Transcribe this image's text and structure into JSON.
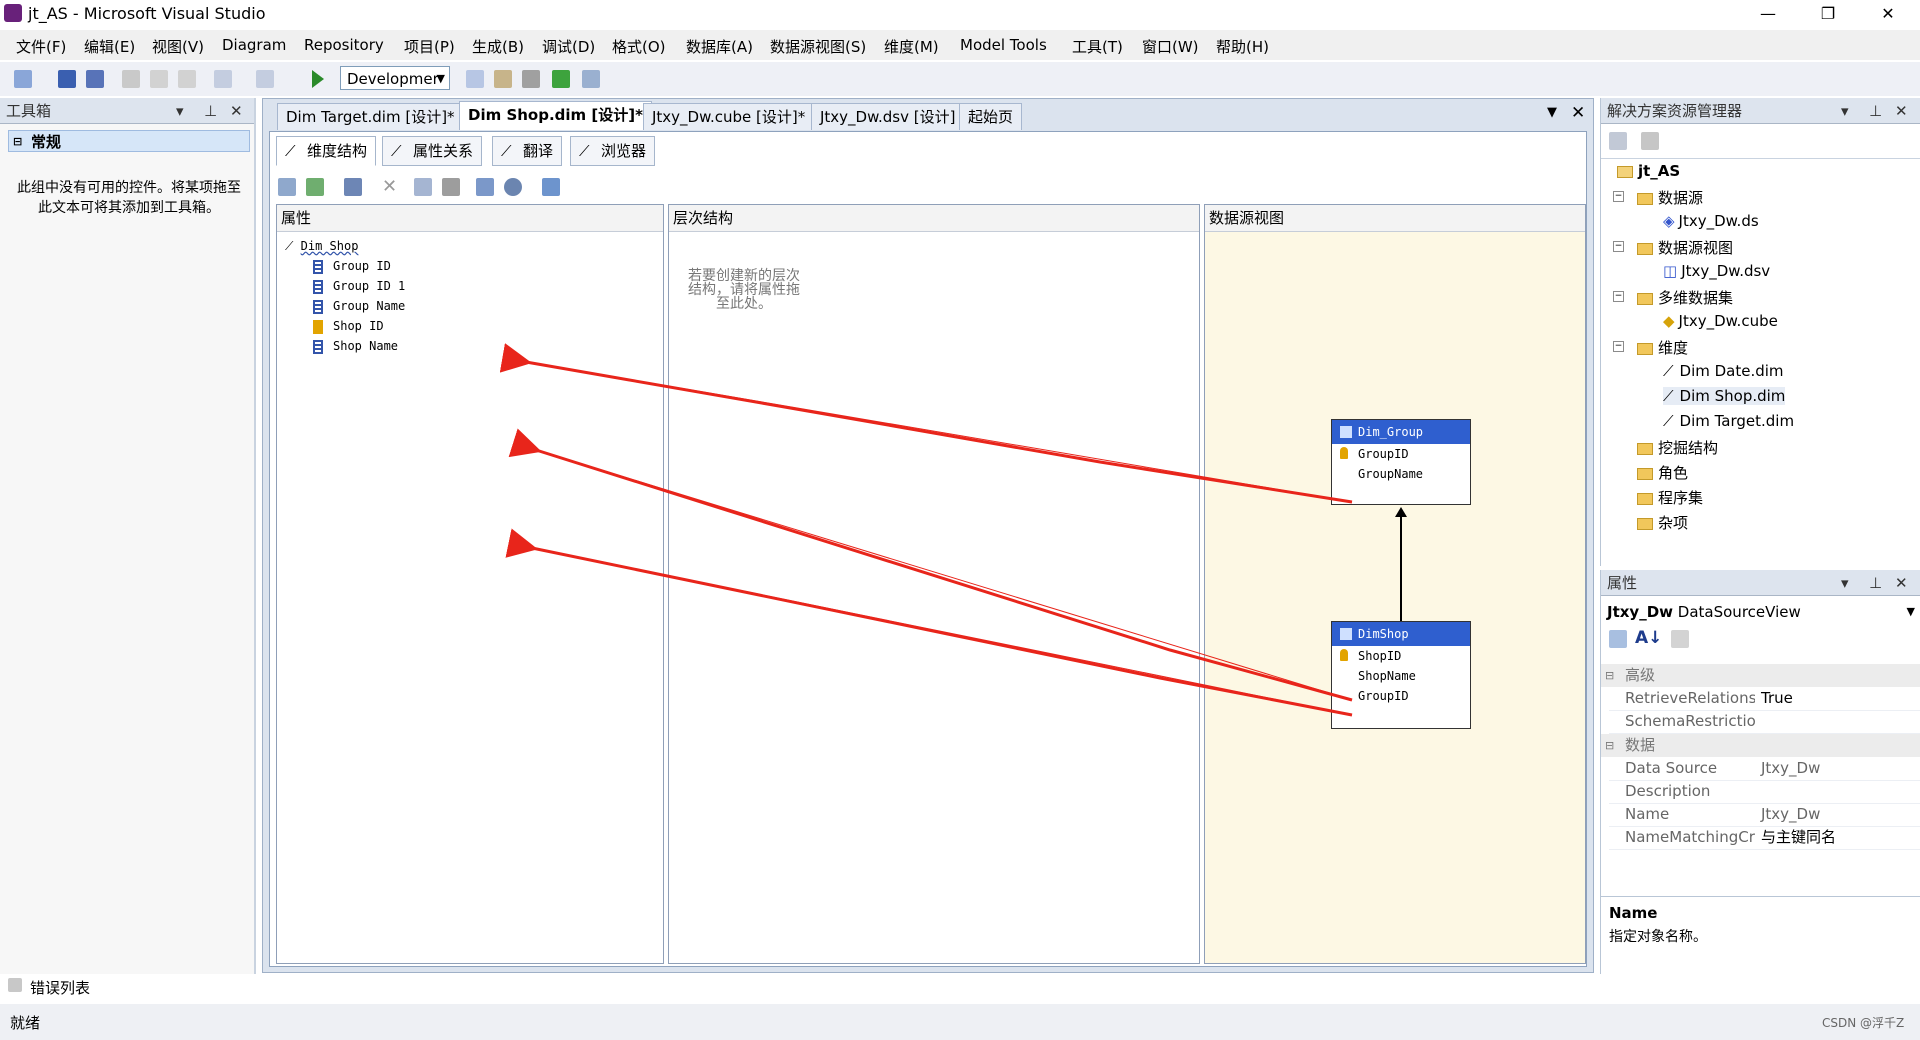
{
  "window": {
    "title": "jt_AS - Microsoft Visual Studio",
    "minimize": "—",
    "restore": "❐",
    "close": "✕"
  },
  "menu": [
    "文件(F)",
    "编辑(E)",
    "视图(V)",
    "Diagram",
    "Repository",
    "项目(P)",
    "生成(B)",
    "调试(D)",
    "格式(O)",
    "数据库(A)",
    "数据源视图(S)",
    "维度(M)",
    "Model Tools",
    "工具(T)",
    "窗口(W)",
    "帮助(H)"
  ],
  "toolbar": {
    "config": "Developmer"
  },
  "toolbox": {
    "title": "工具箱",
    "group": "常规",
    "message": "此组中没有可用的控件。将某项拖至此文本可将其添加到工具箱。"
  },
  "doc_tabs": [
    "Dim Target.dim [设计]*",
    "Dim Shop.dim [设计]*",
    "Jtxy_Dw.cube [设计]*",
    "Jtxy_Dw.dsv [设计]",
    "起始页"
  ],
  "designer_tabs": [
    "维度结构",
    "属性关系",
    "翻译",
    "浏览器"
  ],
  "panes": {
    "attributes": {
      "title": "属性",
      "root": "Dim Shop",
      "items": [
        "Group ID",
        "Group ID 1",
        "Group Name",
        "Shop ID",
        "Shop Name"
      ]
    },
    "hierarchies": {
      "title": "层次结构",
      "hint_line1": "若要创建新的层次",
      "hint_line2": "结构，请将属性拖",
      "hint_line3": "至此处。"
    },
    "dsv": {
      "title": "数据源视图",
      "tables": [
        {
          "name": "Dim_Group",
          "columns": [
            "GroupID",
            "GroupName"
          ]
        },
        {
          "name": "DimShop",
          "columns": [
            "ShopID",
            "ShopName",
            "GroupID"
          ]
        }
      ]
    }
  },
  "solution_explorer": {
    "title": "解决方案资源管理器",
    "root": "jt_AS",
    "nodes": [
      "数据源",
      "Jtxy_Dw.ds",
      "数据源视图",
      "Jtxy_Dw.dsv",
      "多维数据集",
      "Jtxy_Dw.cube",
      "维度",
      "Dim Date.dim",
      "Dim Shop.dim",
      "Dim Target.dim",
      "挖掘结构",
      "角色",
      "程序集",
      "杂项"
    ]
  },
  "properties": {
    "title": "属性",
    "object_name": "Jtxy_Dw",
    "object_type": "DataSourceView",
    "categories": [
      "高级",
      "数据"
    ],
    "rows": [
      {
        "name": "RetrieveRelationsh",
        "value": "True"
      },
      {
        "name": "SchemaRestrictior",
        "value": ""
      },
      {
        "name": "Data Source",
        "value": "Jtxy_Dw"
      },
      {
        "name": "Description",
        "value": ""
      },
      {
        "name": "Name",
        "value": "Jtxy_Dw"
      },
      {
        "name": "NameMatchingCri",
        "value": "与主键同名"
      }
    ],
    "desc_title": "Name",
    "desc_text": "指定对象名称。"
  },
  "bottom": {
    "error_list": "错误列表",
    "status": "就绪",
    "watermark": "CSDN @浮千Z"
  }
}
